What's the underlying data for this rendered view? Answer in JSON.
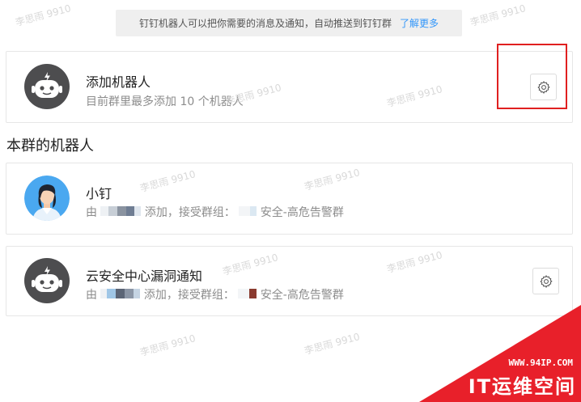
{
  "notice": {
    "text": "钉钉机器人可以把你需要的消息及通知，自动推送到钉钉群",
    "link": "了解更多"
  },
  "add_robot": {
    "title": "添加机器人",
    "subtitle": "目前群里最多添加 10 个机器人",
    "avatar_icon": "robot-icon",
    "settings_icon": "gear-icon"
  },
  "section": {
    "title": "本群的机器人"
  },
  "robots": [
    {
      "name": "小钉",
      "desc_prefix": "由",
      "desc_mid": "添加，接受群组：",
      "desc_suffix": "安全-高危告警群",
      "avatar_icon": "person-avatar"
    },
    {
      "name": "云安全中心漏洞通知",
      "desc_prefix": "由",
      "desc_mid": "添加，接受群组：",
      "desc_suffix": "安全-高危告警群",
      "avatar_icon": "robot-icon",
      "settings_icon": "gear-icon"
    }
  ],
  "watermark": "李思雨 9910",
  "corner_badge": {
    "site": "WWW.94IP.COM",
    "brand": "IT运维空间"
  },
  "colors": {
    "link": "#3296fa",
    "highlight": "#e02020",
    "badge": "#e8202a"
  }
}
